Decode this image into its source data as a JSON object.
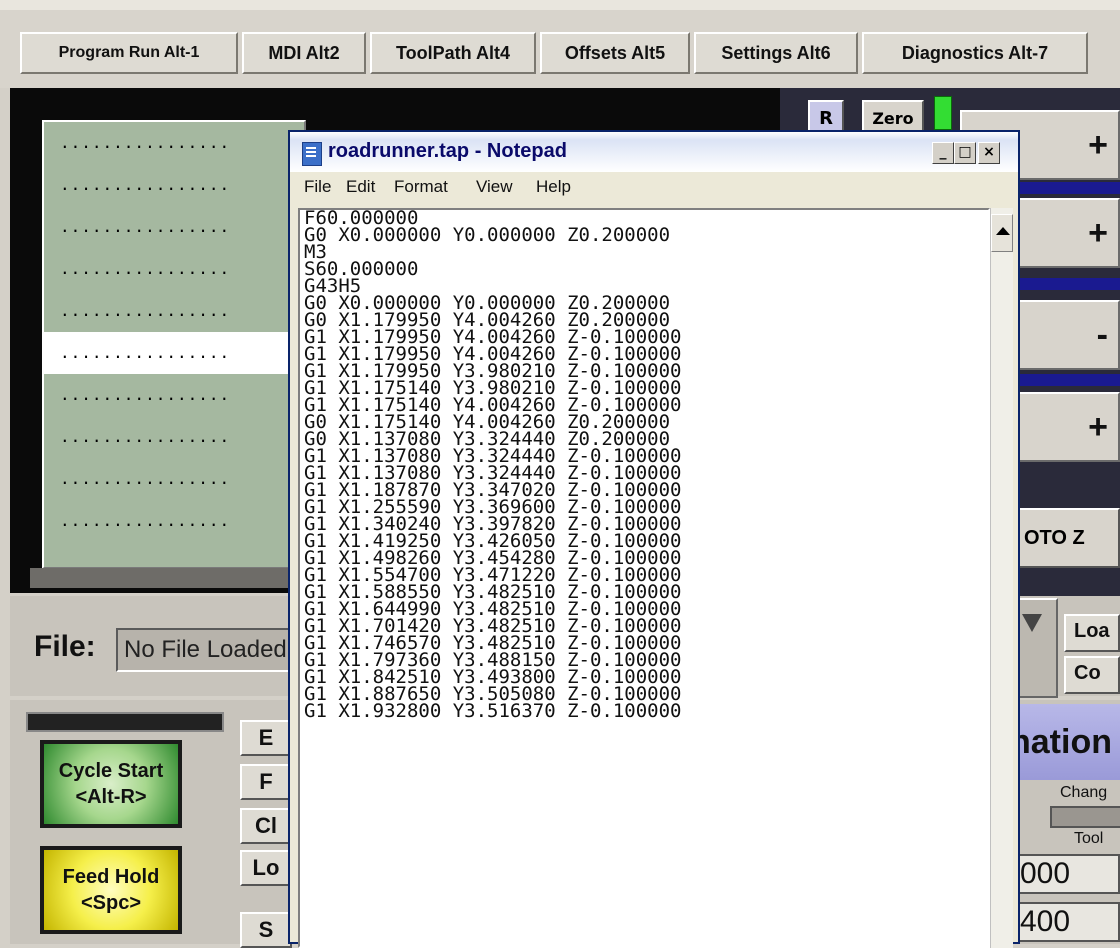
{
  "tabs": [
    {
      "label": "Program Run Alt-1"
    },
    {
      "label": "MDI Alt2"
    },
    {
      "label": "ToolPath Alt4"
    },
    {
      "label": "Offsets Alt5"
    },
    {
      "label": "Settings Alt6"
    },
    {
      "label": "Diagnostics Alt-7"
    }
  ],
  "code_view": {
    "rows": [
      "................",
      "................",
      "................",
      "................",
      "................",
      "................",
      "................",
      "................",
      "................",
      "................"
    ],
    "selected_index": 5
  },
  "dro": {
    "r_label": "R",
    "zero_label": "Zero",
    "plus1": "+",
    "plus2": "+",
    "minus": "-",
    "plus3": "+",
    "gotoz": "OTO Z"
  },
  "file": {
    "label": "File:",
    "value": "No File Loaded"
  },
  "side_buttons": {
    "load": "Loa",
    "close": "Co"
  },
  "controls": {
    "cycle_start": "Cycle Start",
    "cycle_start_key": "<Alt-R>",
    "feed_hold": "Feed Hold",
    "feed_hold_key": "<Spc>",
    "small_buttons": [
      "E",
      "F",
      "Cl",
      "Lo",
      "S"
    ]
  },
  "info": {
    "heading": "nation",
    "change_label": "Chang",
    "tool_label": "Tool",
    "value1": "000",
    "value2": "400"
  },
  "notepad": {
    "title": "roadrunner.tap - Notepad",
    "minimize": "_",
    "maximize": "□",
    "close": "×",
    "menu": [
      "File",
      "Edit",
      "Format",
      "View",
      "Help"
    ],
    "lines": [
      "F60.000000",
      "G0 X0.000000 Y0.000000 Z0.200000",
      "M3",
      "S60.000000",
      "G43H5",
      "G0 X0.000000 Y0.000000 Z0.200000",
      "G0 X1.179950 Y4.004260 Z0.200000",
      "G1 X1.179950 Y4.004260 Z-0.100000",
      "G1 X1.179950 Y4.004260 Z-0.100000",
      "G1 X1.179950 Y3.980210 Z-0.100000",
      "G1 X1.175140 Y3.980210 Z-0.100000",
      "G1 X1.175140 Y4.004260 Z-0.100000",
      "G0 X1.175140 Y4.004260 Z0.200000",
      "G0 X1.137080 Y3.324440 Z0.200000",
      "G1 X1.137080 Y3.324440 Z-0.100000",
      "G1 X1.137080 Y3.324440 Z-0.100000",
      "G1 X1.187870 Y3.347020 Z-0.100000",
      "G1 X1.255590 Y3.369600 Z-0.100000",
      "G1 X1.340240 Y3.397820 Z-0.100000",
      "G1 X1.419250 Y3.426050 Z-0.100000",
      "G1 X1.498260 Y3.454280 Z-0.100000",
      "G1 X1.554700 Y3.471220 Z-0.100000",
      "G1 X1.588550 Y3.482510 Z-0.100000",
      "G1 X1.644990 Y3.482510 Z-0.100000",
      "G1 X1.701420 Y3.482510 Z-0.100000",
      "G1 X1.746570 Y3.482510 Z-0.100000",
      "G1 X1.797360 Y3.488150 Z-0.100000",
      "G1 X1.842510 Y3.493800 Z-0.100000",
      "G1 X1.887650 Y3.505080 Z-0.100000",
      "G1 X1.932800 Y3.516370 Z-0.100000"
    ]
  }
}
